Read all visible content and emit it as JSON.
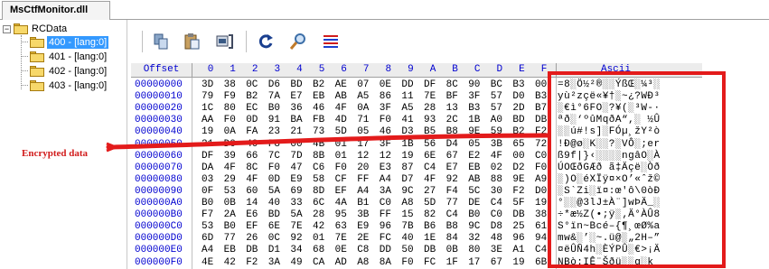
{
  "tab": {
    "title": "MsCtfMonitor.dll"
  },
  "tree": {
    "root": "RCData",
    "items": [
      {
        "label": "400 - [lang:0]",
        "selected": true
      },
      {
        "label": "401 - [lang:0]",
        "selected": false
      },
      {
        "label": "402 - [lang:0]",
        "selected": false
      },
      {
        "label": "403 - [lang:0]",
        "selected": false
      }
    ]
  },
  "toolbar": {
    "icons": [
      "copy-icon",
      "paste-icon",
      "insert-icon",
      "refresh-icon",
      "find-icon",
      "options-icon"
    ]
  },
  "hex": {
    "offset_header": "Offset",
    "columns": [
      "0",
      "1",
      "2",
      "3",
      "4",
      "5",
      "6",
      "7",
      "8",
      "9",
      "A",
      "B",
      "C",
      "D",
      "E",
      "F"
    ],
    "ascii_header": "Ascii",
    "rows": [
      {
        "offset": "00000000",
        "bytes": [
          "3D",
          "38",
          "0C",
          "D6",
          "BD",
          "B2",
          "AE",
          "07",
          "0E",
          "DD",
          "DF",
          "8C",
          "90",
          "BC",
          "B3",
          "00"
        ],
        "ascii": "=8░Ö½²®░░ÝßŒ░¼³░"
      },
      {
        "offset": "00000010",
        "bytes": [
          "79",
          "F9",
          "B2",
          "7A",
          "E7",
          "EB",
          "AB",
          "A5",
          "86",
          "11",
          "7E",
          "BF",
          "3F",
          "57",
          "D0",
          "B3"
        ],
        "ascii": "yù²zçë«¥†░~¿?WÐ³"
      },
      {
        "offset": "00000020",
        "bytes": [
          "1C",
          "80",
          "EC",
          "B0",
          "36",
          "46",
          "4F",
          "0A",
          "3F",
          "A5",
          "28",
          "13",
          "B3",
          "57",
          "2D",
          "B7"
        ],
        "ascii": "░€ì°6FO░?¥(░³W-·"
      },
      {
        "offset": "00000030",
        "bytes": [
          "AA",
          "F0",
          "0D",
          "91",
          "BA",
          "FB",
          "4D",
          "71",
          "F0",
          "41",
          "93",
          "2C",
          "1B",
          "A0",
          "BD",
          "DB"
        ],
        "ascii": "ªð░‘ºûMqðA“,░ ½Û"
      },
      {
        "offset": "00000040",
        "bytes": [
          "19",
          "0A",
          "FA",
          "23",
          "21",
          "73",
          "5D",
          "05",
          "46",
          "D3",
          "B5",
          "B8",
          "9E",
          "59",
          "B2",
          "F2"
        ],
        "ascii": "░░ú#!s]░FÓµ¸žY²ò"
      },
      {
        "offset": "00000050",
        "bytes": [
          "21",
          "D0",
          "40",
          "F8",
          "00",
          "4B",
          "01",
          "17",
          "3F",
          "1B",
          "56",
          "D4",
          "05",
          "3B",
          "65",
          "72"
        ],
        "ascii": "!Ð@ø░K░░?░VÔ░;er"
      },
      {
        "offset": "00000060",
        "bytes": [
          "DF",
          "39",
          "66",
          "7C",
          "7D",
          "8B",
          "01",
          "12",
          "12",
          "19",
          "6E",
          "67",
          "E2",
          "4F",
          "00",
          "C0"
        ],
        "ascii": "ß9f|}‹░░░░ngâO░À"
      },
      {
        "offset": "00000070",
        "bytes": [
          "DA",
          "4F",
          "8C",
          "F0",
          "47",
          "C6",
          "F0",
          "20",
          "E3",
          "87",
          "C4",
          "E7",
          "EB",
          "02",
          "D2",
          "F0"
        ],
        "ascii": "ÚOŒðGÆð ã‡Äçë░Òð"
      },
      {
        "offset": "00000080",
        "bytes": [
          "03",
          "29",
          "4F",
          "0D",
          "E9",
          "58",
          "CF",
          "FF",
          "A4",
          "D7",
          "4F",
          "92",
          "AB",
          "88",
          "9E",
          "A9"
        ],
        "ascii": "░)O░éXÏÿ¤×O’«ˆž©"
      },
      {
        "offset": "00000090",
        "bytes": [
          "0F",
          "53",
          "60",
          "5A",
          "69",
          "8D",
          "EF",
          "A4",
          "3A",
          "9C",
          "27",
          "F4",
          "5C",
          "30",
          "F2",
          "D0"
        ],
        "ascii": "░S`Zi░ï¤:œ'ô\\0òÐ"
      },
      {
        "offset": "000000A0",
        "bytes": [
          "B0",
          "0B",
          "14",
          "40",
          "33",
          "6C",
          "4A",
          "B1",
          "C0",
          "A8",
          "5D",
          "77",
          "DE",
          "C4",
          "5F",
          "19"
        ],
        "ascii": "°░░@3lJ±À¨]wÞÄ_░"
      },
      {
        "offset": "000000B0",
        "bytes": [
          "F7",
          "2A",
          "E6",
          "BD",
          "5A",
          "28",
          "95",
          "3B",
          "FF",
          "15",
          "82",
          "C4",
          "B0",
          "C0",
          "DB",
          "38"
        ],
        "ascii": "÷*æ½Z(•;ÿ░‚Ä°ÀÛ8"
      },
      {
        "offset": "000000C0",
        "bytes": [
          "53",
          "B0",
          "EF",
          "6E",
          "7E",
          "42",
          "63",
          "E9",
          "96",
          "7B",
          "B6",
          "B8",
          "9C",
          "D8",
          "25",
          "61"
        ],
        "ascii": "S°ïn~Bcé–{¶¸œØ%a"
      },
      {
        "offset": "000000D0",
        "bytes": [
          "6D",
          "77",
          "26",
          "0C",
          "92",
          "01",
          "7E",
          "2E",
          "FC",
          "40",
          "1E",
          "84",
          "32",
          "48",
          "96",
          "94"
        ],
        "ascii": "mw&░’░~.ü@░„2H–”"
      },
      {
        "offset": "000000E0",
        "bytes": [
          "A4",
          "EB",
          "DB",
          "D1",
          "34",
          "68",
          "0E",
          "C8",
          "DD",
          "50",
          "DB",
          "0B",
          "80",
          "3E",
          "A1",
          "C4"
        ],
        "ascii": "¤ëÛÑ4h░ÈÝPÛ░€>¡Ä"
      },
      {
        "offset": "000000F0",
        "bytes": [
          "4E",
          "42",
          "F2",
          "3A",
          "49",
          "CA",
          "AD",
          "A8",
          "8A",
          "F0",
          "FC",
          "1F",
          "17",
          "67",
          "19",
          "6B"
        ],
        "ascii": "NBò:IÊ­¨Šðü░░g░k"
      }
    ]
  },
  "annotation": {
    "label": "Encrypted data",
    "color": "#e31b1b"
  }
}
